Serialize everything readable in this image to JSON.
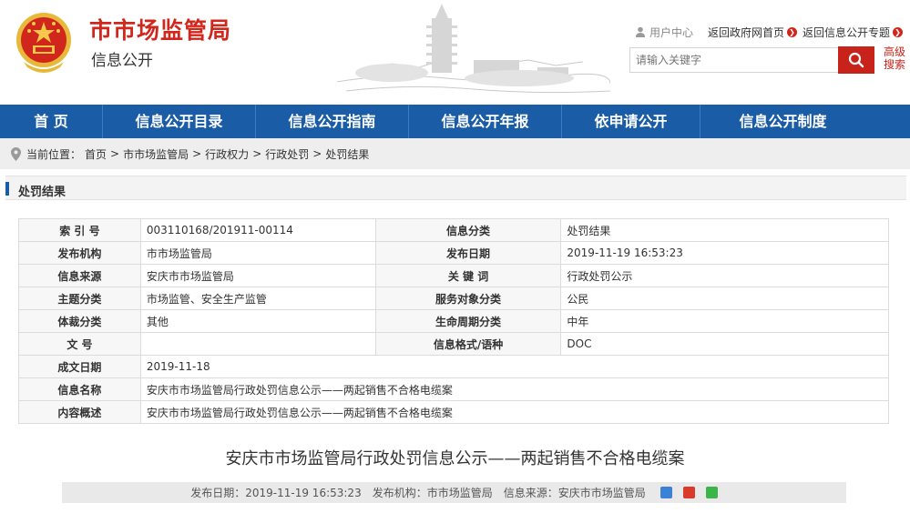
{
  "header": {
    "site_title": "市市场监管局",
    "site_subtitle": "信息公开",
    "user_center": "用户中心",
    "links": [
      "返回政府网首页",
      "返回信息公开专题"
    ],
    "search_placeholder": "请输入关键字",
    "advanced_search": "高级搜索"
  },
  "nav": [
    "首 页",
    "信息公开目录",
    "信息公开指南",
    "信息公开年报",
    "依申请公开",
    "信息公开制度"
  ],
  "breadcrumb": {
    "prefix": "当前位置：",
    "items": [
      "首页",
      ">",
      "市市场监管局",
      ">",
      "行政权力",
      ">",
      "行政处罚",
      ">",
      "处罚结果"
    ]
  },
  "section": {
    "title": "处罚结果"
  },
  "meta": {
    "rows": [
      [
        "索 引 号",
        "003110168/201911-00114",
        "信息分类",
        "处罚结果"
      ],
      [
        "发布机构",
        "市市场监管局",
        "发布日期",
        "2019-11-19 16:53:23"
      ],
      [
        "信息来源",
        "安庆市市场监管局",
        "关 键 词",
        "行政处罚公示"
      ],
      [
        "主题分类",
        "市场监管、安全生产监管",
        "服务对象分类",
        "公民"
      ],
      [
        "体裁分类",
        "其他",
        "生命周期分类",
        "中年"
      ],
      [
        "文 号",
        "",
        "信息格式/语种",
        "DOC"
      ]
    ],
    "wide_rows": [
      [
        "成文日期",
        "2019-11-18"
      ],
      [
        "信息名称",
        "安庆市市场监管局行政处罚信息公示——两起销售不合格电缆案"
      ],
      [
        "内容概述",
        "安庆市市场监管局行政处罚信息公示——两起销售不合格电缆案"
      ]
    ]
  },
  "article": {
    "title": "安庆市市场监管局行政处罚信息公示——两起销售不合格电缆案",
    "info": [
      "发布日期：2019-11-19 16:53:23",
      "发布机构：市市场监管局",
      "信息来源：安庆市市场监管局"
    ]
  },
  "colors": {
    "brand_red": "#d1261c",
    "nav_blue": "#1a5ca6"
  }
}
